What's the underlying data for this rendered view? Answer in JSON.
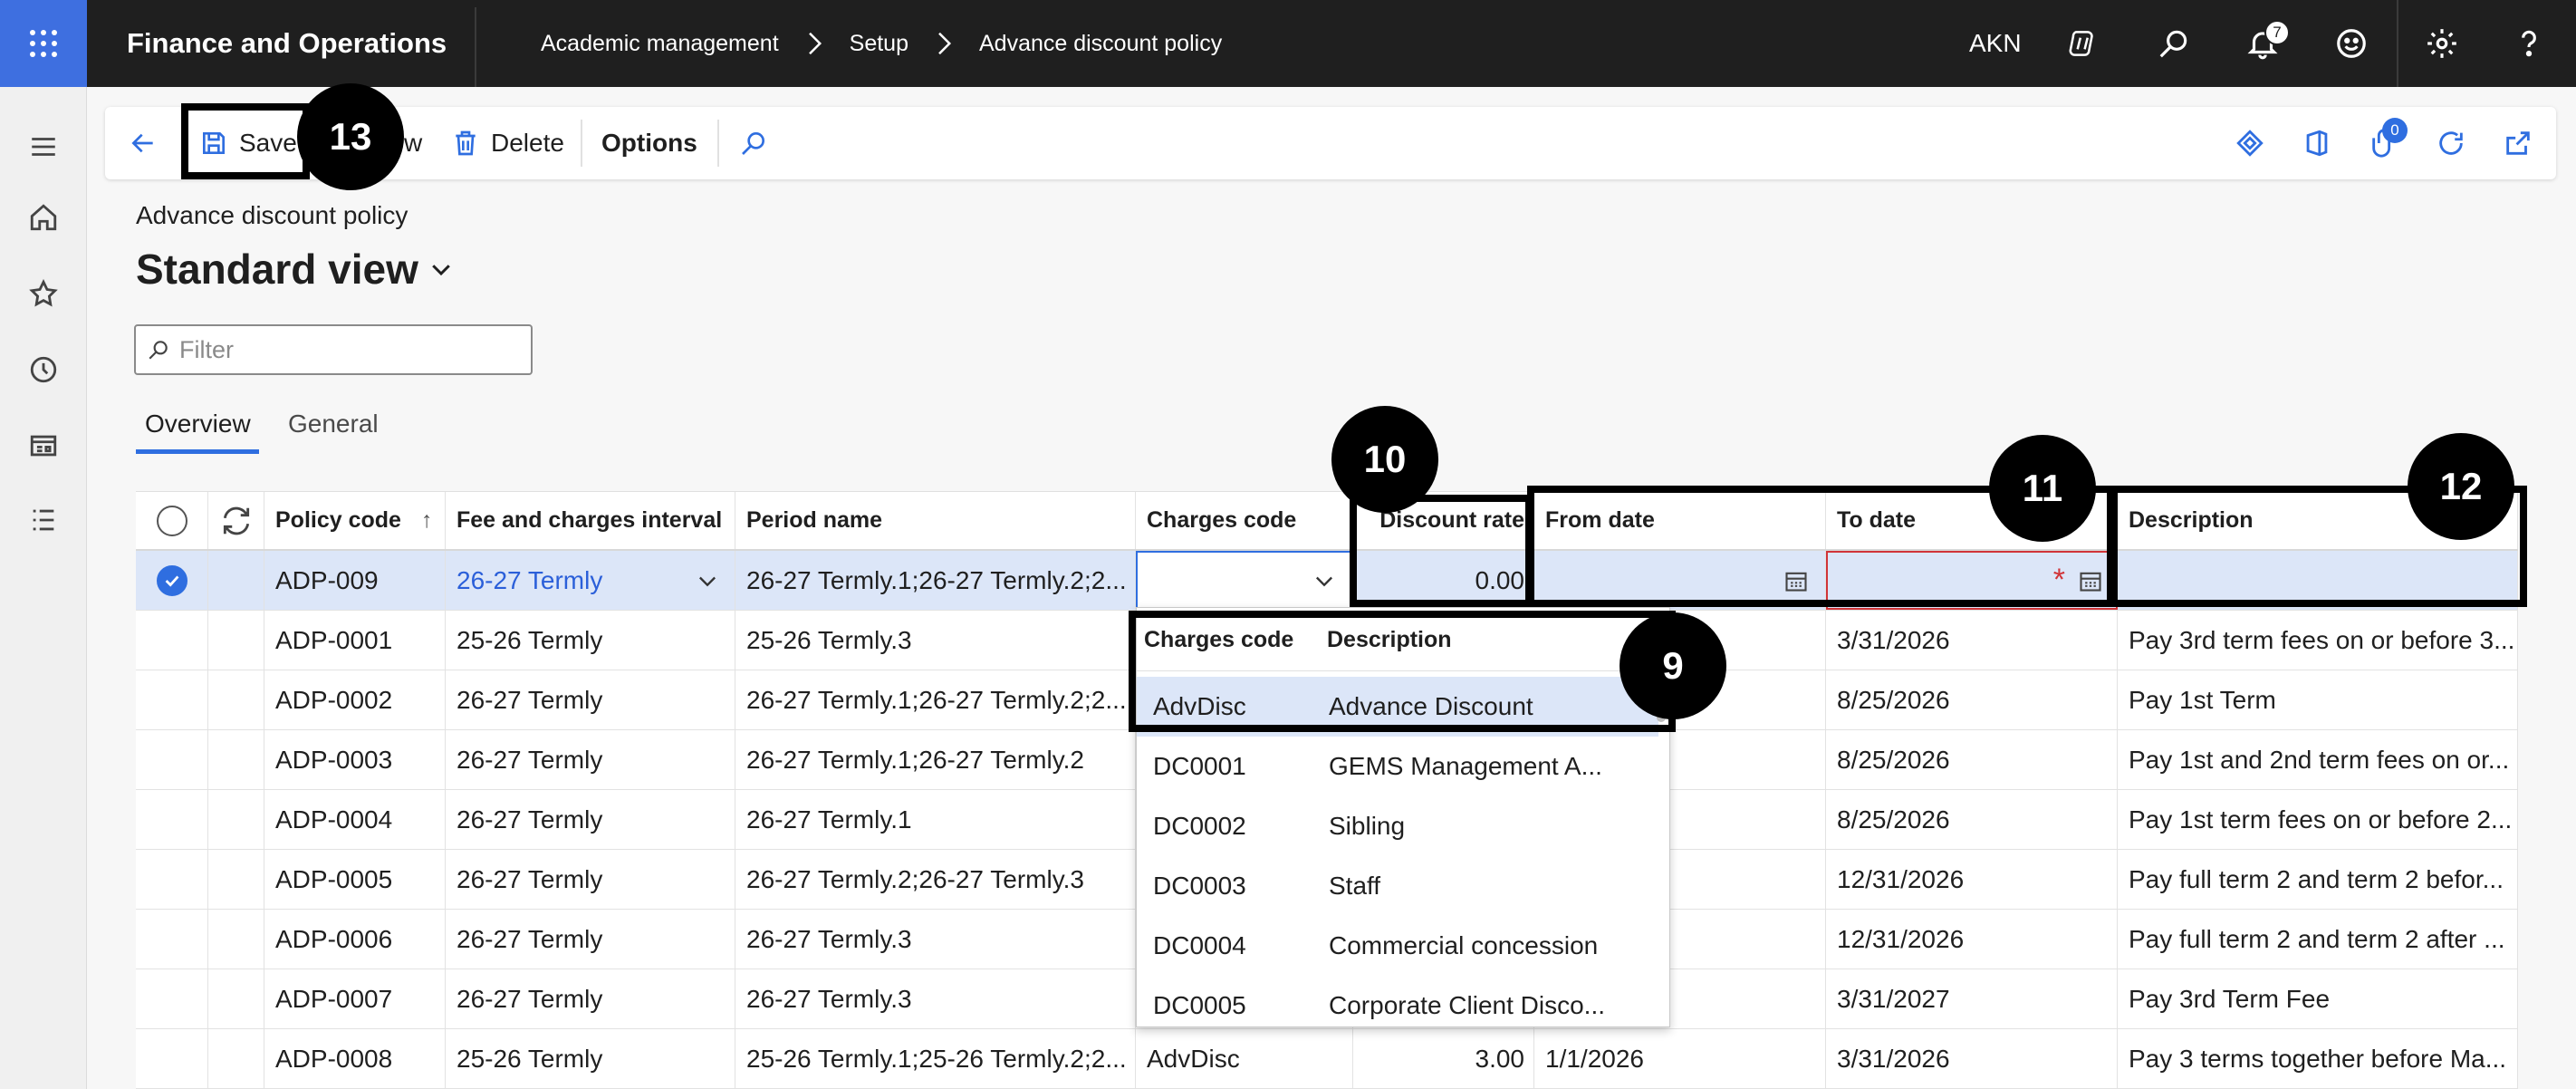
{
  "topbar": {
    "app_name": "Finance and Operations",
    "breadcrumbs": [
      "Academic management",
      "Setup",
      "Advance discount policy"
    ],
    "company": "AKN",
    "notification_count": "7",
    "icons": [
      "waffle-icon",
      "copilot-icon",
      "search-icon",
      "bell-icon",
      "feedback-icon",
      "gear-icon",
      "help-icon"
    ]
  },
  "nav_rail": {
    "icons": [
      "hamburger-icon",
      "home-icon",
      "star-icon",
      "recent-icon",
      "workspace-icon",
      "modules-icon"
    ]
  },
  "actions": {
    "save": "Save",
    "new_partial": "w",
    "delete": "Delete",
    "options": "Options",
    "attachments_count": "0"
  },
  "page": {
    "caption": "Advance discount policy",
    "view": "Standard view",
    "filter_placeholder": "Filter",
    "tabs": [
      "Overview",
      "General"
    ]
  },
  "grid": {
    "columns": [
      "Policy code",
      "Fee and charges interval",
      "Period name",
      "Charges code",
      "Discount rate",
      "From date",
      "To date",
      "Description"
    ],
    "sort_indicator": "↑",
    "new_row": {
      "policy_code": "ADP-009",
      "interval": "26-27 Termly",
      "period": "26-27 Termly.1;26-27 Termly.2;2...",
      "charges_code": "",
      "discount_rate": "0.00",
      "from_date": "",
      "to_date": "",
      "description": ""
    },
    "rows": [
      {
        "policy_code": "ADP-0001",
        "interval": "25-26 Termly",
        "period": "25-26 Termly.3",
        "charges_code": "",
        "discount_rate": "",
        "from_date": "",
        "to_date": "3/31/2026",
        "description": "Pay 3rd term fees on or before 3..."
      },
      {
        "policy_code": "ADP-0002",
        "interval": "26-27 Termly",
        "period": "26-27 Termly.1;26-27 Termly.2;2...",
        "charges_code": "",
        "discount_rate": "",
        "from_date": "",
        "to_date": "8/25/2026",
        "description": "Pay 1st Term"
      },
      {
        "policy_code": "ADP-0003",
        "interval": "26-27 Termly",
        "period": "26-27 Termly.1;26-27 Termly.2",
        "charges_code": "",
        "discount_rate": "",
        "from_date": "",
        "to_date": "8/25/2026",
        "description": "Pay 1st and 2nd term fees on or..."
      },
      {
        "policy_code": "ADP-0004",
        "interval": "26-27 Termly",
        "period": "26-27 Termly.1",
        "charges_code": "",
        "discount_rate": "",
        "from_date": "",
        "to_date": "8/25/2026",
        "description": "Pay 1st term fees on or before 2..."
      },
      {
        "policy_code": "ADP-0005",
        "interval": "26-27 Termly",
        "period": "26-27 Termly.2;26-27 Termly.3",
        "charges_code": "",
        "discount_rate": "",
        "from_date": "",
        "to_date": "12/31/2026",
        "description": "Pay full term 2 and term 2 befor..."
      },
      {
        "policy_code": "ADP-0006",
        "interval": "26-27 Termly",
        "period": "26-27 Termly.3",
        "charges_code": "",
        "discount_rate": "",
        "from_date": "",
        "to_date": "12/31/2026",
        "description": "Pay full term 2 and term 2 after ..."
      },
      {
        "policy_code": "ADP-0007",
        "interval": "26-27 Termly",
        "period": "26-27 Termly.3",
        "charges_code": "",
        "discount_rate": "",
        "from_date": "",
        "to_date": "3/31/2027",
        "description": "Pay 3rd Term Fee"
      },
      {
        "policy_code": "ADP-0008",
        "interval": "25-26 Termly",
        "period": "25-26 Termly.1;25-26 Termly.2;2...",
        "charges_code": "AdvDisc",
        "discount_rate": "3.00",
        "from_date": "1/1/2026",
        "to_date": "3/31/2026",
        "description": "Pay 3 terms together before Ma..."
      }
    ]
  },
  "lookup": {
    "headers": [
      "Charges code",
      "Description"
    ],
    "items": [
      {
        "code": "AdvDisc",
        "description": "Advance Discount"
      },
      {
        "code": "DC0001",
        "description": "GEMS Management A..."
      },
      {
        "code": "DC0002",
        "description": "Sibling"
      },
      {
        "code": "DC0003",
        "description": "Staff"
      },
      {
        "code": "DC0004",
        "description": "Commercial concession"
      },
      {
        "code": "DC0005",
        "description": "Corporate Client Disco..."
      }
    ]
  },
  "callouts": {
    "save": "13",
    "lookup": "9",
    "discount": "10",
    "dates": "11",
    "description": "12"
  },
  "colors": {
    "topbar": "#1f1f1f",
    "accent": "#2f6ee0",
    "selected_row": "#dce6f8",
    "required": "#d13438",
    "callout": "#000000"
  }
}
